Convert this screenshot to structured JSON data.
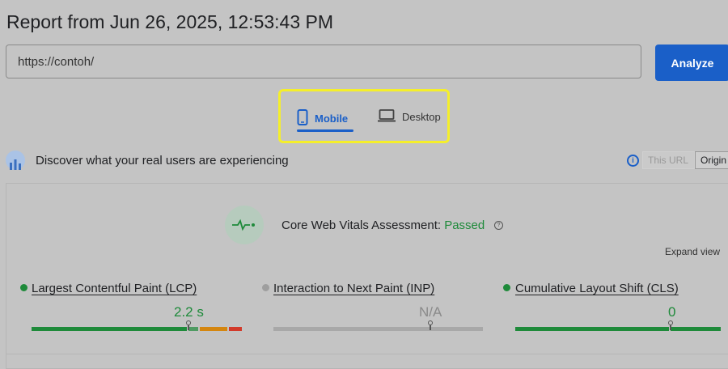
{
  "header": {
    "title": "Report from Jun 26, 2025, 12:53:43 PM"
  },
  "url_bar": {
    "value": "https://contoh/",
    "analyze_label": "Analyze"
  },
  "device_tabs": {
    "mobile_label": "Mobile",
    "desktop_label": "Desktop",
    "selected": "Mobile"
  },
  "crux": {
    "heading": "Discover what your real users are experiencing",
    "toggle_this_url": "This URL",
    "toggle_origin": "Origin"
  },
  "assessment": {
    "label": "Core Web Vitals Assessment:",
    "status": "Passed",
    "help_glyph": "?",
    "expand_label": "Expand view"
  },
  "metrics": [
    {
      "name": "Largest Contentful Paint (LCP)",
      "value": "2.2 s",
      "status_color": "#1e8a3a",
      "value_color": "#1e8a3a"
    },
    {
      "name": "Interaction to Next Paint (INP)",
      "value": "N/A",
      "status_color": "#9e9e9e",
      "value_color": "#8a8a8a"
    },
    {
      "name": "Cumulative Layout Shift (CLS)",
      "value": "0",
      "status_color": "#1e8a3a",
      "value_color": "#1e8a3a"
    }
  ],
  "colors": {
    "accent": "#1a5fc8",
    "good": "#1e8a3a",
    "needs_improvement": "#d4860f",
    "poor": "#d23a2a",
    "highlight": "#f5ef2a"
  },
  "icons": [
    "mobile-icon",
    "desktop-icon",
    "crux-people-icon",
    "info-icon",
    "pulse-icon",
    "help-icon"
  ]
}
